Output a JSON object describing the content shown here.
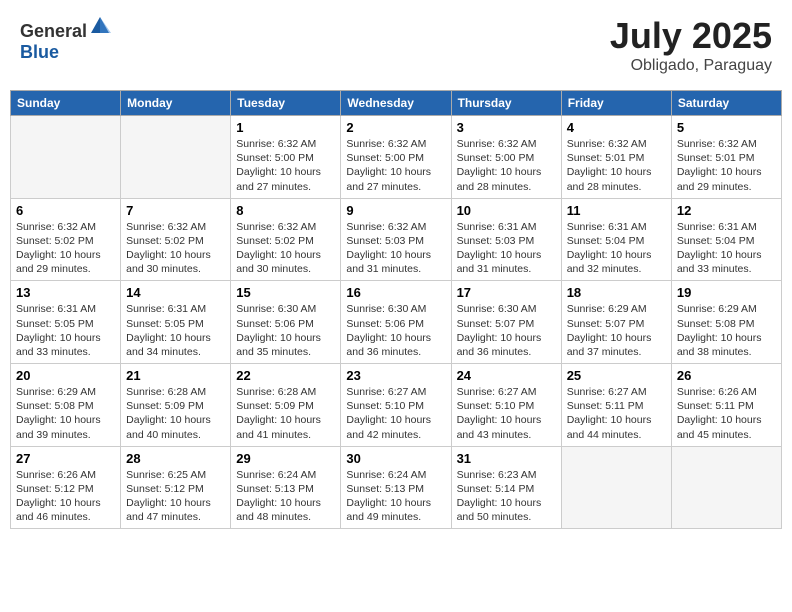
{
  "header": {
    "logo_general": "General",
    "logo_blue": "Blue",
    "title": "July 2025",
    "location": "Obligado, Paraguay"
  },
  "weekdays": [
    "Sunday",
    "Monday",
    "Tuesday",
    "Wednesday",
    "Thursday",
    "Friday",
    "Saturday"
  ],
  "weeks": [
    [
      {
        "day": "",
        "info": ""
      },
      {
        "day": "",
        "info": ""
      },
      {
        "day": "1",
        "info": "Sunrise: 6:32 AM\nSunset: 5:00 PM\nDaylight: 10 hours and 27 minutes."
      },
      {
        "day": "2",
        "info": "Sunrise: 6:32 AM\nSunset: 5:00 PM\nDaylight: 10 hours and 27 minutes."
      },
      {
        "day": "3",
        "info": "Sunrise: 6:32 AM\nSunset: 5:00 PM\nDaylight: 10 hours and 28 minutes."
      },
      {
        "day": "4",
        "info": "Sunrise: 6:32 AM\nSunset: 5:01 PM\nDaylight: 10 hours and 28 minutes."
      },
      {
        "day": "5",
        "info": "Sunrise: 6:32 AM\nSunset: 5:01 PM\nDaylight: 10 hours and 29 minutes."
      }
    ],
    [
      {
        "day": "6",
        "info": "Sunrise: 6:32 AM\nSunset: 5:02 PM\nDaylight: 10 hours and 29 minutes."
      },
      {
        "day": "7",
        "info": "Sunrise: 6:32 AM\nSunset: 5:02 PM\nDaylight: 10 hours and 30 minutes."
      },
      {
        "day": "8",
        "info": "Sunrise: 6:32 AM\nSunset: 5:02 PM\nDaylight: 10 hours and 30 minutes."
      },
      {
        "day": "9",
        "info": "Sunrise: 6:32 AM\nSunset: 5:03 PM\nDaylight: 10 hours and 31 minutes."
      },
      {
        "day": "10",
        "info": "Sunrise: 6:31 AM\nSunset: 5:03 PM\nDaylight: 10 hours and 31 minutes."
      },
      {
        "day": "11",
        "info": "Sunrise: 6:31 AM\nSunset: 5:04 PM\nDaylight: 10 hours and 32 minutes."
      },
      {
        "day": "12",
        "info": "Sunrise: 6:31 AM\nSunset: 5:04 PM\nDaylight: 10 hours and 33 minutes."
      }
    ],
    [
      {
        "day": "13",
        "info": "Sunrise: 6:31 AM\nSunset: 5:05 PM\nDaylight: 10 hours and 33 minutes."
      },
      {
        "day": "14",
        "info": "Sunrise: 6:31 AM\nSunset: 5:05 PM\nDaylight: 10 hours and 34 minutes."
      },
      {
        "day": "15",
        "info": "Sunrise: 6:30 AM\nSunset: 5:06 PM\nDaylight: 10 hours and 35 minutes."
      },
      {
        "day": "16",
        "info": "Sunrise: 6:30 AM\nSunset: 5:06 PM\nDaylight: 10 hours and 36 minutes."
      },
      {
        "day": "17",
        "info": "Sunrise: 6:30 AM\nSunset: 5:07 PM\nDaylight: 10 hours and 36 minutes."
      },
      {
        "day": "18",
        "info": "Sunrise: 6:29 AM\nSunset: 5:07 PM\nDaylight: 10 hours and 37 minutes."
      },
      {
        "day": "19",
        "info": "Sunrise: 6:29 AM\nSunset: 5:08 PM\nDaylight: 10 hours and 38 minutes."
      }
    ],
    [
      {
        "day": "20",
        "info": "Sunrise: 6:29 AM\nSunset: 5:08 PM\nDaylight: 10 hours and 39 minutes."
      },
      {
        "day": "21",
        "info": "Sunrise: 6:28 AM\nSunset: 5:09 PM\nDaylight: 10 hours and 40 minutes."
      },
      {
        "day": "22",
        "info": "Sunrise: 6:28 AM\nSunset: 5:09 PM\nDaylight: 10 hours and 41 minutes."
      },
      {
        "day": "23",
        "info": "Sunrise: 6:27 AM\nSunset: 5:10 PM\nDaylight: 10 hours and 42 minutes."
      },
      {
        "day": "24",
        "info": "Sunrise: 6:27 AM\nSunset: 5:10 PM\nDaylight: 10 hours and 43 minutes."
      },
      {
        "day": "25",
        "info": "Sunrise: 6:27 AM\nSunset: 5:11 PM\nDaylight: 10 hours and 44 minutes."
      },
      {
        "day": "26",
        "info": "Sunrise: 6:26 AM\nSunset: 5:11 PM\nDaylight: 10 hours and 45 minutes."
      }
    ],
    [
      {
        "day": "27",
        "info": "Sunrise: 6:26 AM\nSunset: 5:12 PM\nDaylight: 10 hours and 46 minutes."
      },
      {
        "day": "28",
        "info": "Sunrise: 6:25 AM\nSunset: 5:12 PM\nDaylight: 10 hours and 47 minutes."
      },
      {
        "day": "29",
        "info": "Sunrise: 6:24 AM\nSunset: 5:13 PM\nDaylight: 10 hours and 48 minutes."
      },
      {
        "day": "30",
        "info": "Sunrise: 6:24 AM\nSunset: 5:13 PM\nDaylight: 10 hours and 49 minutes."
      },
      {
        "day": "31",
        "info": "Sunrise: 6:23 AM\nSunset: 5:14 PM\nDaylight: 10 hours and 50 minutes."
      },
      {
        "day": "",
        "info": ""
      },
      {
        "day": "",
        "info": ""
      }
    ]
  ]
}
